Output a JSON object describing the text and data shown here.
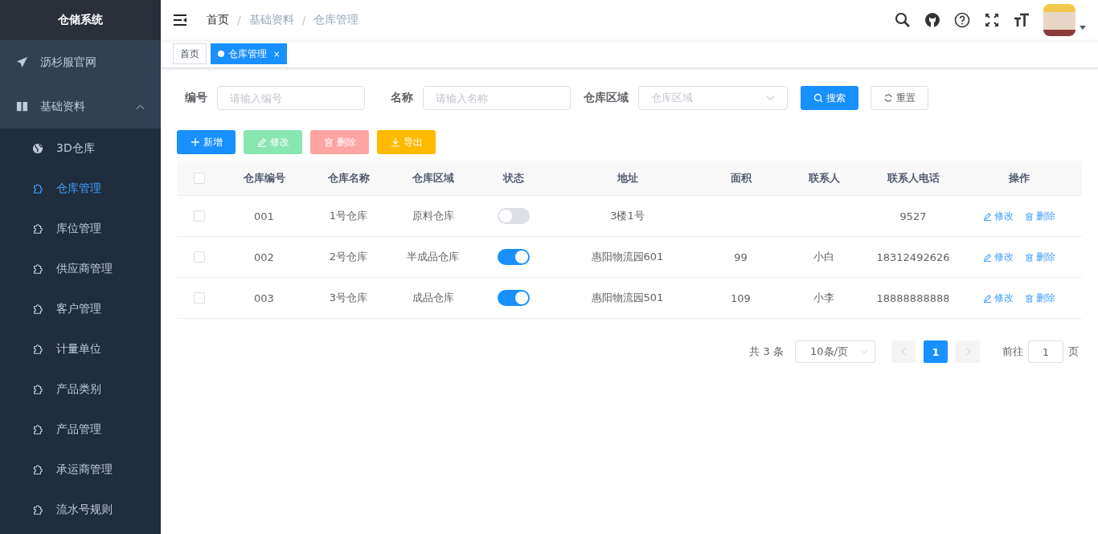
{
  "sidebar": {
    "title": "仓储系统",
    "items": [
      {
        "label": "沥杉服官网",
        "kind": "link"
      },
      {
        "label": "基础资料",
        "kind": "group",
        "expanded": true,
        "children": [
          {
            "label": "3D仓库",
            "kind": "globe",
            "selected": false
          },
          {
            "label": "仓库管理",
            "kind": "page",
            "selected": true
          },
          {
            "label": "库位管理",
            "kind": "page",
            "selected": false
          },
          {
            "label": "供应商管理",
            "kind": "page",
            "selected": false
          },
          {
            "label": "客户管理",
            "kind": "page",
            "selected": false
          },
          {
            "label": "计量单位",
            "kind": "page",
            "selected": false
          },
          {
            "label": "产品类别",
            "kind": "page",
            "selected": false
          },
          {
            "label": "产品管理",
            "kind": "page",
            "selected": false
          },
          {
            "label": "承运商管理",
            "kind": "page",
            "selected": false
          },
          {
            "label": "流水号规则",
            "kind": "page",
            "selected": false
          }
        ]
      }
    ]
  },
  "breadcrumb": [
    {
      "label": "首页"
    },
    {
      "separator": "/",
      "label": "基础资料"
    },
    {
      "separator": "/",
      "label": "仓库管理"
    }
  ],
  "tabs": [
    {
      "label": "首页",
      "selected": false
    },
    {
      "label": "仓库管理",
      "selected": true,
      "close": "×"
    }
  ],
  "filters": [
    {
      "label": "编号",
      "placeholder": "请输入编号",
      "kind": "input"
    },
    {
      "label": "名称",
      "placeholder": "请输入名称",
      "kind": "input"
    },
    {
      "label": "仓库区域",
      "placeholder": "仓库区域",
      "kind": "select"
    }
  ],
  "search_button": "搜索",
  "reset_button": "重置",
  "toolbar": [
    {
      "label": "新增",
      "kind": "add",
      "disabled": false
    },
    {
      "label": "修改",
      "kind": "edit",
      "disabled": true
    },
    {
      "label": "删除",
      "kind": "delete",
      "disabled": true
    },
    {
      "label": "导出",
      "kind": "export",
      "disabled": false
    }
  ],
  "table": {
    "columns": [
      "仓库编号",
      "仓库名称",
      "仓库区域",
      "状态",
      "地址",
      "面积",
      "联系人",
      "联系人电话",
      "操作"
    ],
    "all_checked": false,
    "rows": [
      {
        "checked": false,
        "code": "001",
        "name": "1号仓库",
        "area": "原料仓库",
        "on": false,
        "address": "3楼1号",
        "size": "",
        "contact": "",
        "phone": "9527",
        "actions": [
          "修改",
          "删除"
        ]
      },
      {
        "checked": false,
        "code": "002",
        "name": "2号仓库",
        "area": "半成品仓库",
        "on": true,
        "address": "惠阳物流园601",
        "size": "99",
        "contact": "小白",
        "phone": "18312492626",
        "actions": [
          "修改",
          "删除"
        ]
      },
      {
        "checked": false,
        "code": "003",
        "name": "3号仓库",
        "area": "成品仓库",
        "on": true,
        "address": "惠阳物流园501",
        "size": "109",
        "contact": "小李",
        "phone": "18888888888",
        "actions": [
          "修改",
          "删除"
        ]
      }
    ]
  },
  "pagination": {
    "total": "共 3 条",
    "page_size": "10条/页",
    "pages": [
      {
        "label": "1",
        "selected": true
      }
    ],
    "goto_label": "前往",
    "goto_value": "1",
    "goto_suffix": "页"
  }
}
